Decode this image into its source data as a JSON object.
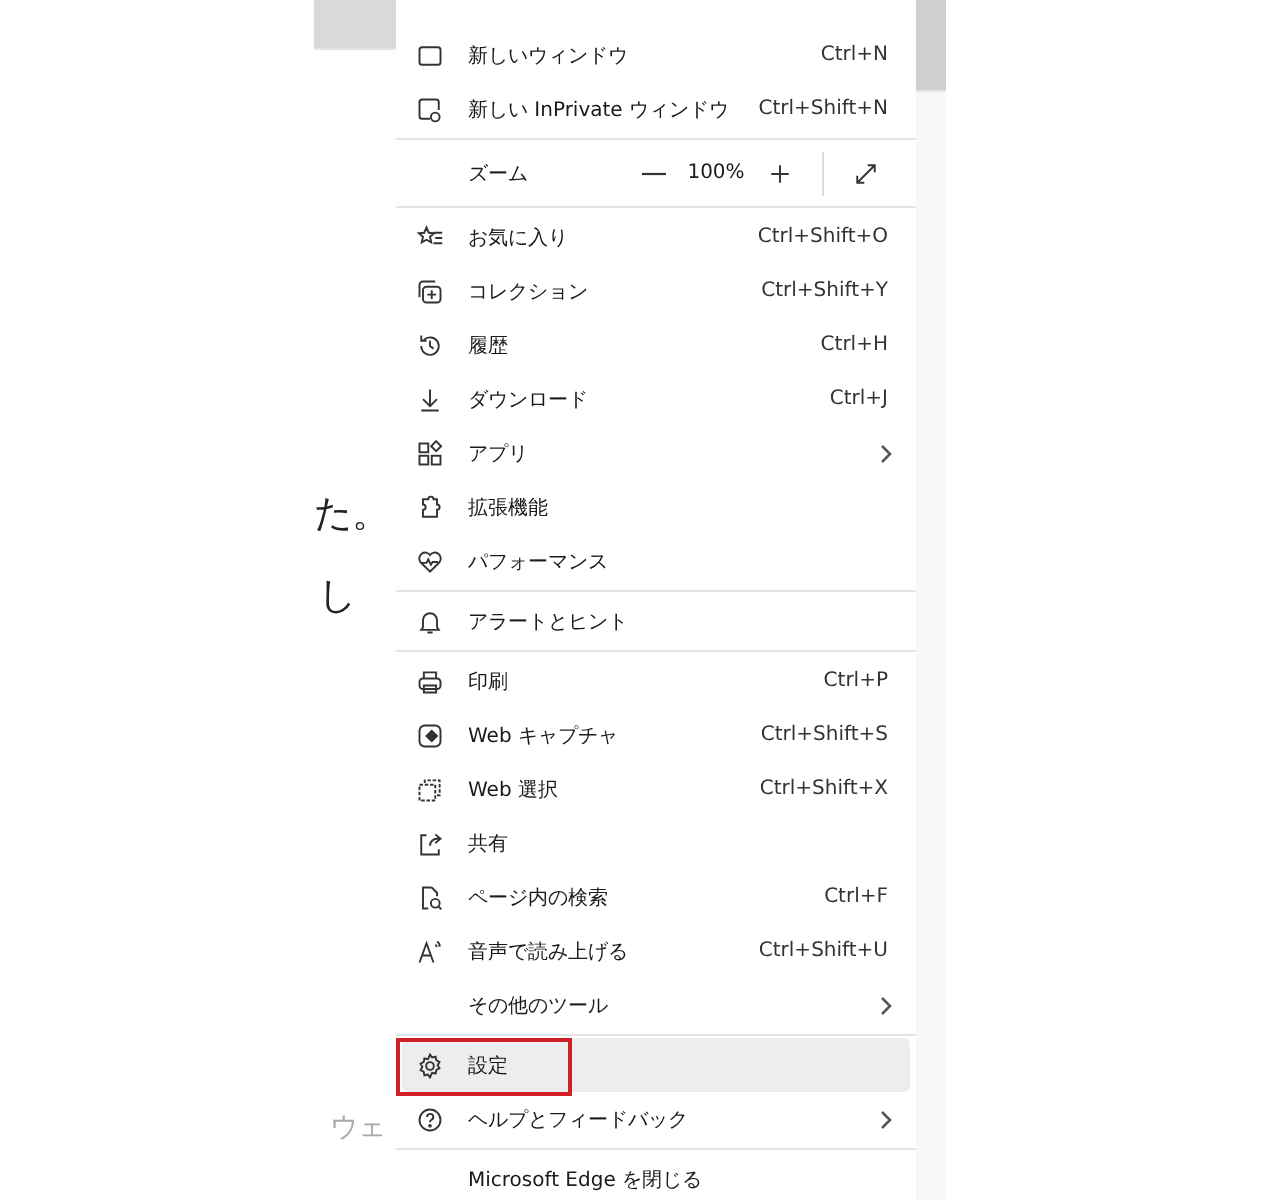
{
  "page_behind": {
    "fragments": [
      {
        "text": "た。",
        "kind": "large"
      },
      {
        "text": "し",
        "kind": "large"
      },
      {
        "text": "ウェ",
        "kind": "small"
      }
    ]
  },
  "menu": {
    "sections": [
      {
        "items": [
          {
            "kind": "item",
            "label": "新しいウィンドウ",
            "shortcut": "Ctrl+N"
          },
          {
            "kind": "item",
            "label": "新しい InPrivate ウィンドウ",
            "shortcut": "Ctrl+Shift+N"
          }
        ]
      },
      {
        "items": [
          {
            "kind": "zoom",
            "label": "ズーム",
            "value": "100%"
          }
        ]
      },
      {
        "items": [
          {
            "kind": "item",
            "label": "お気に入り",
            "shortcut": "Ctrl+Shift+O"
          },
          {
            "kind": "item",
            "label": "コレクション",
            "shortcut": "Ctrl+Shift+Y"
          },
          {
            "kind": "item",
            "label": "履歴",
            "shortcut": "Ctrl+H"
          },
          {
            "kind": "item",
            "label": "ダウンロード",
            "shortcut": "Ctrl+J"
          },
          {
            "kind": "item",
            "label": "アプリ",
            "submenu": true
          },
          {
            "kind": "item",
            "label": "拡張機能"
          },
          {
            "kind": "item",
            "label": "パフォーマンス"
          }
        ]
      },
      {
        "items": [
          {
            "kind": "item",
            "label": "アラートとヒント"
          }
        ]
      },
      {
        "items": [
          {
            "kind": "item",
            "label": "印刷",
            "shortcut": "Ctrl+P"
          },
          {
            "kind": "item",
            "label": "Web キャプチャ",
            "shortcut": "Ctrl+Shift+S"
          },
          {
            "kind": "item",
            "label": "Web 選択",
            "shortcut": "Ctrl+Shift+X"
          },
          {
            "kind": "item",
            "label": "共有"
          },
          {
            "kind": "item",
            "label": "ページ内の検索",
            "shortcut": "Ctrl+F"
          },
          {
            "kind": "item",
            "label": "音声で読み上げる",
            "shortcut": "Ctrl+Shift+U"
          },
          {
            "kind": "item",
            "label": "その他のツール",
            "submenu": true
          }
        ]
      },
      {
        "items": [
          {
            "kind": "item",
            "label": "設定",
            "selected": true,
            "marked": true
          },
          {
            "kind": "item",
            "label": "ヘルプとフィードバック",
            "submenu": true
          }
        ]
      },
      {
        "items": [
          {
            "kind": "item",
            "label": "Microsoft Edge を閉じる"
          }
        ]
      }
    ]
  }
}
